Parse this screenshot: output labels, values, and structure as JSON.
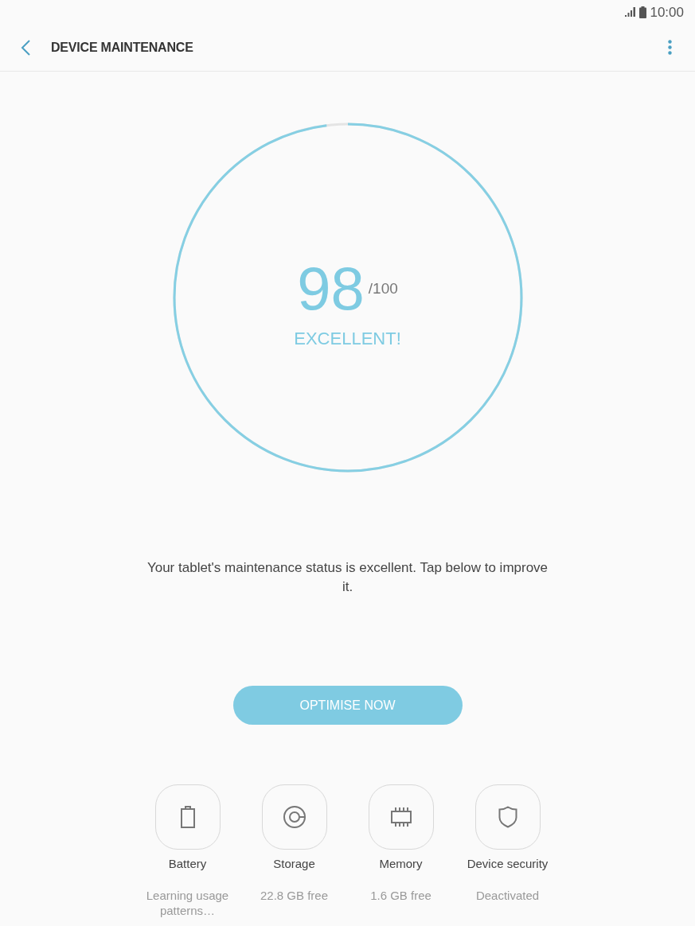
{
  "status_bar": {
    "time": "10:00"
  },
  "header": {
    "title": "DEVICE MAINTENANCE"
  },
  "score": {
    "value": "98",
    "max": "/100",
    "rating": "EXCELLENT!",
    "level": 0.98
  },
  "message": "Your tablet's maintenance status is excellent. Tap below to improve it.",
  "action_button": {
    "label": "OPTIMISE NOW"
  },
  "tools": [
    {
      "kind": "battery",
      "label": "Battery",
      "status": "Learning usage patterns…"
    },
    {
      "kind": "storage",
      "label": "Storage",
      "status": "22.8 GB free"
    },
    {
      "kind": "memory",
      "label": "Memory",
      "status": "1.6 GB free"
    },
    {
      "kind": "security",
      "label": "Device security",
      "status": "Deactivated"
    }
  ]
}
